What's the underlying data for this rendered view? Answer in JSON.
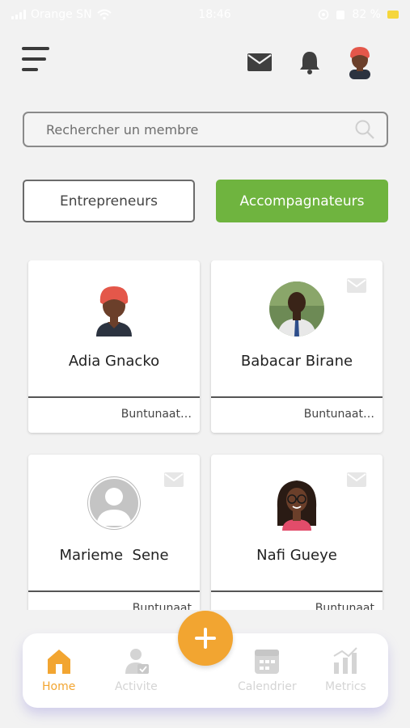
{
  "status_bar": {
    "carrier": "Orange SN",
    "time": "18:46",
    "battery": "82 %"
  },
  "header": {
    "menu_icon": "hamburger-menu-icon",
    "mail_icon": "mail-icon",
    "bell_icon": "bell-icon",
    "avatar_icon": "user-avatar"
  },
  "search": {
    "placeholder": "Rechercher un membre",
    "value": ""
  },
  "filters": {
    "entrepreneurs_label": "Entrepreneurs",
    "accompagnateurs_label": "Accompagnateurs",
    "active": "Accompagnateurs"
  },
  "members": [
    {
      "name": "Adia Gnacko",
      "org": "Buntunaat…",
      "avatar": "woman-red-headwrap"
    },
    {
      "name": "Babacar Birane",
      "org": "Buntunaat…",
      "avatar": "man-photo"
    },
    {
      "name": "Marieme  Sene",
      "org": "Buntunaat",
      "avatar": "default-person"
    },
    {
      "name": "Nafi Gueye",
      "org": "Buntunaat",
      "avatar": "woman-glasses"
    }
  ],
  "bottom_nav": {
    "home": "Home",
    "activite": "Activite",
    "calendrier": "Calendrier",
    "metrics": "Metrics",
    "fab_icon": "plus-icon"
  },
  "colors": {
    "accent_green": "#6fb43f",
    "accent_orange": "#f2a531",
    "inactive_gray": "#d4d4d4"
  }
}
